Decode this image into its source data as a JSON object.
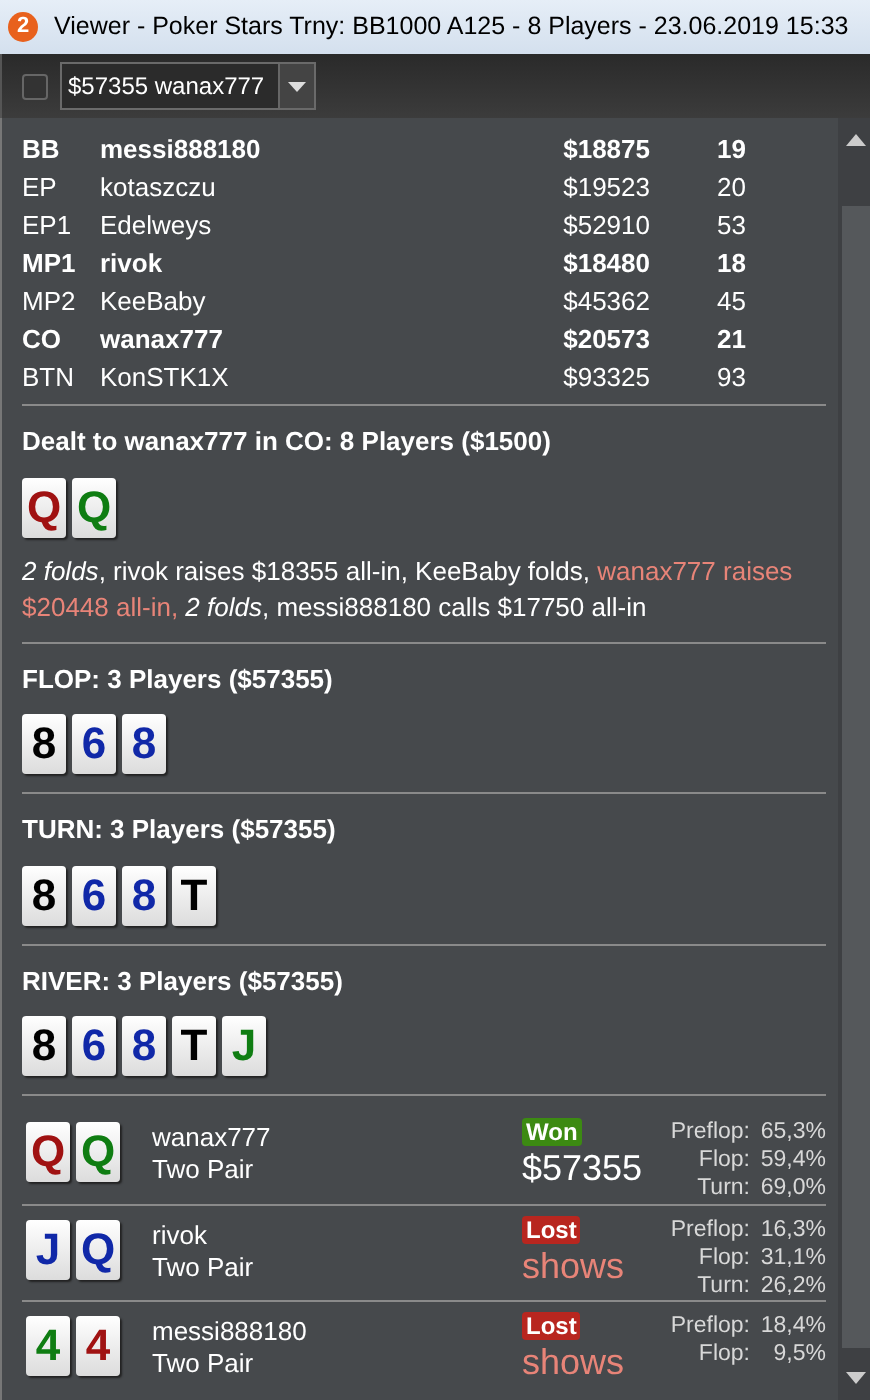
{
  "window": {
    "badge": "2",
    "title": "Viewer - Poker Stars Trny: BB1000 A125 - 8 Players - 23.06.2019 15:33"
  },
  "toolbar": {
    "checked": false,
    "hand_select": "$57355 wanax777"
  },
  "players": [
    {
      "position": "BB",
      "name": "messi888180",
      "stack": "$18875",
      "bb": "19",
      "in_showdown": true
    },
    {
      "position": "EP",
      "name": "kotaszczu",
      "stack": "$19523",
      "bb": "20",
      "in_showdown": false
    },
    {
      "position": "EP1",
      "name": "Edelweys",
      "stack": "$52910",
      "bb": "53",
      "in_showdown": false
    },
    {
      "position": "MP1",
      "name": "rivok",
      "stack": "$18480",
      "bb": "18",
      "in_showdown": true
    },
    {
      "position": "MP2",
      "name": "KeeBaby",
      "stack": "$45362",
      "bb": "45",
      "in_showdown": false
    },
    {
      "position": "CO",
      "name": "wanax777",
      "stack": "$20573",
      "bb": "21",
      "in_showdown": true
    },
    {
      "position": "BTN",
      "name": "KonSTK1X",
      "stack": "$93325",
      "bb": "93",
      "in_showdown": false
    }
  ],
  "preflop": {
    "title": "Dealt to wanax777 in CO: 8 Players ($1500)",
    "cards": [
      {
        "rank": "Q",
        "color": "#a01212"
      },
      {
        "rank": "Q",
        "color": "#0f7d12"
      }
    ],
    "actions": [
      {
        "text": "*2 folds*, rivok raises $18355 all-in, KeeBaby folds, ",
        "hero": false
      },
      {
        "text": "wanax777 raises $20448 all-in, ",
        "hero": true
      },
      {
        "text": "*2 folds*, messi888180 calls $17750 all-in",
        "hero": false
      }
    ]
  },
  "streets": [
    {
      "title": "FLOP: 3 Players ($57355)",
      "cards": [
        {
          "rank": "8",
          "color": "#000000"
        },
        {
          "rank": "6",
          "color": "#1028a8"
        },
        {
          "rank": "8",
          "color": "#1028a8"
        }
      ]
    },
    {
      "title": "TURN: 3 Players ($57355)",
      "cards": [
        {
          "rank": "8",
          "color": "#000000"
        },
        {
          "rank": "6",
          "color": "#1028a8"
        },
        {
          "rank": "8",
          "color": "#1028a8"
        },
        {
          "rank": "T",
          "color": "#000000"
        }
      ]
    },
    {
      "title": "RIVER: 3 Players ($57355)",
      "cards": [
        {
          "rank": "8",
          "color": "#000000"
        },
        {
          "rank": "6",
          "color": "#1028a8"
        },
        {
          "rank": "8",
          "color": "#1028a8"
        },
        {
          "rank": "T",
          "color": "#000000"
        },
        {
          "rank": "J",
          "color": "#0f7d12"
        }
      ]
    }
  ],
  "showdown": [
    {
      "cards": [
        {
          "rank": "Q",
          "color": "#a01212"
        },
        {
          "rank": "Q",
          "color": "#0f7d12"
        }
      ],
      "name": "wanax777",
      "hand": "Two Pair",
      "won": true,
      "badge": "Won",
      "amount": "$57355",
      "stats": [
        {
          "label": "Preflop:",
          "value": "65,3%"
        },
        {
          "label": "Flop:",
          "value": "59,4%"
        },
        {
          "label": "Turn:",
          "value": "69,0%"
        }
      ]
    },
    {
      "cards": [
        {
          "rank": "J",
          "color": "#1028a8"
        },
        {
          "rank": "Q",
          "color": "#1028a8"
        }
      ],
      "name": "rivok",
      "hand": "Two Pair",
      "won": false,
      "badge": "Lost",
      "amount": "shows",
      "stats": [
        {
          "label": "Preflop:",
          "value": "16,3%"
        },
        {
          "label": "Flop:",
          "value": "31,1%"
        },
        {
          "label": "Turn:",
          "value": "26,2%"
        }
      ]
    },
    {
      "cards": [
        {
          "rank": "4",
          "color": "#0f7d12"
        },
        {
          "rank": "4",
          "color": "#a01212"
        }
      ],
      "name": "messi888180",
      "hand": "Two Pair",
      "won": false,
      "badge": "Lost",
      "amount": "shows",
      "stats": [
        {
          "label": "Preflop:",
          "value": "18,4%"
        },
        {
          "label": "Flop:",
          "value": "9,5%"
        }
      ]
    }
  ]
}
